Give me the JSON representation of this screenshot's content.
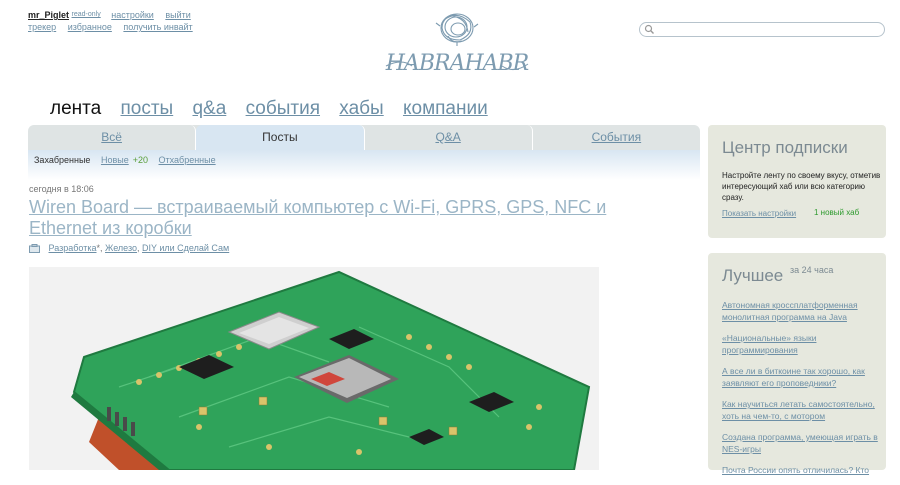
{
  "user": {
    "name": "mr_Piglet",
    "badge": "read-only",
    "settings": "настройки",
    "logout": "выйти",
    "tracker": "трекер",
    "favorites": "избранное",
    "invite": "получить инвайт"
  },
  "logo": {
    "text": "HABRAHABR"
  },
  "search": {
    "placeholder": ""
  },
  "main_nav": {
    "active": "лента",
    "items": [
      "посты",
      "q&a",
      "события",
      "хабы",
      "компании"
    ]
  },
  "tabs": {
    "items": [
      "Всё",
      "Посты",
      "Q&A",
      "События"
    ],
    "active_index": 1
  },
  "subnav": {
    "current": "Захабренные",
    "new_label": "Новые",
    "new_count": "+20",
    "rejected": "Отхабренные"
  },
  "post": {
    "time": "сегодня в 18:06",
    "title": "Wiren Board — встраиваемый компьютер с Wi-Fi, GPRS, GPS, NFC и Ethernet из коробки",
    "hubs": [
      {
        "label": "Разработка",
        "suffix": "*, "
      },
      {
        "label": "Железо",
        "suffix": ", "
      },
      {
        "label": "DIY или Сделай Сам",
        "suffix": ""
      }
    ]
  },
  "subscriptions": {
    "title": "Центр подписки",
    "description": "Настройте ленту по своему вкусу, отметив интересующий хаб или всю категорию сразу.",
    "configure": "Показать настройки",
    "new_hub": "1 новый хаб"
  },
  "best": {
    "title": "Лучшее",
    "period": "за 24 часа",
    "items": [
      "Автономная кроссплатформенная монолитная программа на Java",
      "«Национальные» языки программирования",
      "А все ли в биткоине так хорошо, как заявляют его проповедники?",
      "Как научиться летать самостоятельно, хоть на чем-то, с мотором",
      "Создана программа, умеющая играть в NES-игры",
      "Почта России опять отличилась? Кто"
    ]
  },
  "colors": {
    "link": "#6d8fa6",
    "sidebar_bg": "#e6e8de",
    "active_tab": "#d8e6f2",
    "board_green": "#2fa35a"
  }
}
